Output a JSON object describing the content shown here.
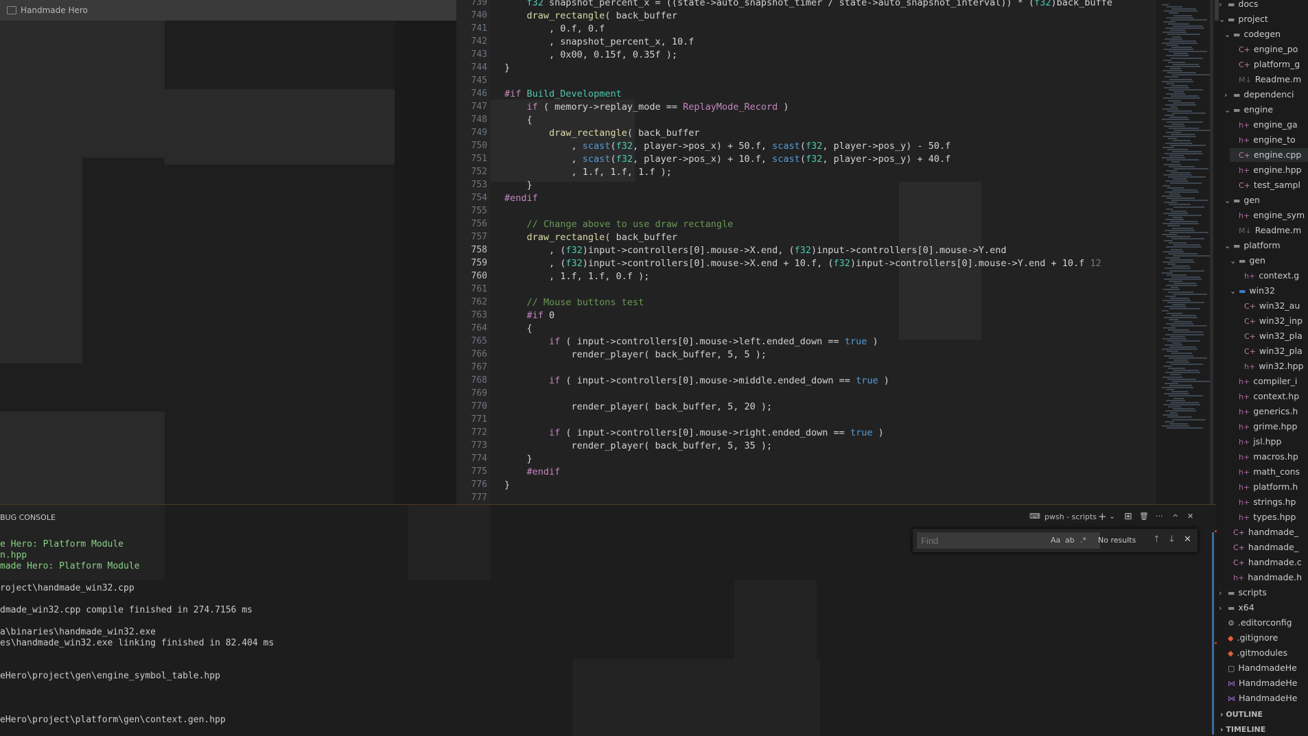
{
  "window": {
    "title": "Handmade Hero",
    "close_glyph": "✕"
  },
  "editor": {
    "lines": [
      {
        "n": "739",
        "html": "    <span style=\"color:#4ec9b0\">f32</span> snapshot_percent_x = ((state-&gt;auto_snapshot_timer / state-&gt;auto_snapshot_interval)) * (<span style=\"color:#4ec9b0\">f32</span>)back_buffe"
      },
      {
        "n": "740",
        "html": "    <span style=\"color:#dcdcaa\">draw_rectangle</span>( back_buffer"
      },
      {
        "n": "741",
        "html": "        , 0.f, 0.f"
      },
      {
        "n": "742",
        "html": "        , snapshot_percent_x, 10.f"
      },
      {
        "n": "743",
        "html": "        , 0x00, 0.15f, 0.35f );"
      },
      {
        "n": "744",
        "html": "}"
      },
      {
        "n": "745",
        "html": ""
      },
      {
        "n": "746",
        "html": "<span style=\"color:#c586c0\">#if</span> <span style=\"color:#4ec9b0\">Build_Development</span>"
      },
      {
        "n": "747",
        "html": "    <span style=\"color:#c586c0\">if</span> ( memory-&gt;replay_mode == <span style=\"color:#c586c0\">ReplayMode_Record</span> )"
      },
      {
        "n": "748",
        "html": "    {"
      },
      {
        "n": "749",
        "html": "        <span style=\"color:#dcdcaa\">draw_rectangle</span>( back_buffer"
      },
      {
        "n": "750",
        "html": "            , <span style=\"color:#569cd6\">scast</span>(<span style=\"color:#4ec9b0\">f32</span>, player-&gt;pos_x) + 50.f, <span style=\"color:#569cd6\">scast</span>(<span style=\"color:#4ec9b0\">f32</span>, player-&gt;pos_y) - 50.f"
      },
      {
        "n": "751",
        "html": "            , <span style=\"color:#569cd6\">scast</span>(<span style=\"color:#4ec9b0\">f32</span>, player-&gt;pos_x) + 10.f, <span style=\"color:#569cd6\">scast</span>(<span style=\"color:#4ec9b0\">f32</span>, player-&gt;pos_y) + 40.f"
      },
      {
        "n": "752",
        "html": "            , 1.f, 1.f, 1.f );"
      },
      {
        "n": "753",
        "html": "    }"
      },
      {
        "n": "754",
        "html": "<span style=\"color:#c586c0\">#endif</span>"
      },
      {
        "n": "755",
        "html": ""
      },
      {
        "n": "756",
        "html": "    <span style=\"color:#6a9955\">// Change above to use draw rectangle</span>"
      },
      {
        "n": "757",
        "html": "    <span style=\"color:#dcdcaa\">draw_rectangle</span>( back_buffer"
      },
      {
        "n": "758",
        "html": "        , (<span style=\"color:#4ec9b0\">f32</span>)input-&gt;controllers[0].mouse-&gt;X.end, (<span style=\"color:#4ec9b0\">f32</span>)input-&gt;controllers[0].mouse-&gt;Y.end"
      },
      {
        "n": "759",
        "html": "        , (<span style=\"color:#4ec9b0\">f32</span>)input-&gt;controllers[0].mouse-&gt;X.end + 10.f, (<span style=\"color:#4ec9b0\">f32</span>)input-&gt;controllers[0].mouse-&gt;Y.end + 10.f <span style=\"color:#777\">12</span>"
      },
      {
        "n": "760",
        "html": "        , 1.f, 1.f, 0.f );"
      },
      {
        "n": "761",
        "html": ""
      },
      {
        "n": "762",
        "html": "    <span style=\"color:#6a9955\">// Mouse buttons test</span>"
      },
      {
        "n": "763",
        "html": "    <span style=\"color:#c586c0\">#if</span> 0"
      },
      {
        "n": "764",
        "html": "    {"
      },
      {
        "n": "765",
        "html": "        <span style=\"color:#c586c0\">if</span> ( input-&gt;controllers[0].mouse-&gt;left.ended_down == <span style=\"color:#569cd6\">true</span> )"
      },
      {
        "n": "766",
        "html": "            render_player( back_buffer, 5, 5 );"
      },
      {
        "n": "767",
        "html": ""
      },
      {
        "n": "768",
        "html": "        <span style=\"color:#c586c0\">if</span> ( input-&gt;controllers[0].mouse-&gt;middle.ended_down == <span style=\"color:#569cd6\">true</span> )"
      },
      {
        "n": "769",
        "html": ""
      },
      {
        "n": "770",
        "html": "            render_player( back_buffer, 5, 20 );"
      },
      {
        "n": "771",
        "html": ""
      },
      {
        "n": "772",
        "html": "        <span style=\"color:#c586c0\">if</span> ( input-&gt;controllers[0].mouse-&gt;right.ended_down == <span style=\"color:#569cd6\">true</span> )"
      },
      {
        "n": "773",
        "html": "            render_player( back_buffer, 5, 35 );"
      },
      {
        "n": "774",
        "html": "    }"
      },
      {
        "n": "775",
        "html": "    <span style=\"color:#c586c0\">#endif</span>"
      },
      {
        "n": "776",
        "html": "}"
      },
      {
        "n": "777",
        "html": ""
      }
    ]
  },
  "terminal": {
    "tab_label": "BUG CONSOLE",
    "shell_label": "pwsh - scripts",
    "lines": [
      {
        "text": "e Hero: Platform Module",
        "green": true
      },
      {
        "text": "n.hpp",
        "green": true
      },
      {
        "text": "made Hero: Platform Module",
        "green": true
      },
      {
        "text": "",
        "green": false
      },
      {
        "text": "roject\\handmade_win32.cpp",
        "green": false
      },
      {
        "text": "",
        "green": false
      },
      {
        "text": "dmade_win32.cpp compile finished in 274.7156 ms",
        "green": false
      },
      {
        "text": "",
        "green": false
      },
      {
        "text": "a\\binaries\\handmade_win32.exe",
        "green": false
      },
      {
        "text": "es\\handmade_win32.exe linking finished in 82.404 ms",
        "green": false
      },
      {
        "text": "",
        "green": false
      },
      {
        "text": "",
        "green": false
      },
      {
        "text": "eHero\\project\\gen\\engine_symbol_table.hpp",
        "green": false
      },
      {
        "text": "",
        "green": false
      },
      {
        "text": "",
        "green": false
      },
      {
        "text": "",
        "green": false
      },
      {
        "text": "eHero\\project\\platform\\gen\\context.gen.hpp",
        "green": false
      }
    ],
    "find": {
      "placeholder": "Find",
      "match_case": "Aa",
      "whole_word": "ab",
      "regex": ".*",
      "results": "No results",
      "prev": "↑",
      "next": "↓",
      "close": "✕"
    },
    "tools": {
      "add": "+",
      "split": "⊞",
      "trash": "🗑",
      "more": "···",
      "maximize": "^",
      "close": "✕"
    }
  },
  "explorer": {
    "items": [
      {
        "label": "docs",
        "depth": 0,
        "type": "folder",
        "chev": "›",
        "icon_color": "#8a8a8a"
      },
      {
        "label": "project",
        "depth": 0,
        "type": "folder",
        "chev": "⌄",
        "icon_color": "#8a8a8a"
      },
      {
        "label": "codegen",
        "depth": 1,
        "type": "folder",
        "chev": "⌄",
        "icon_color": "#8a8a8a"
      },
      {
        "label": "engine_po",
        "depth": 2,
        "type": "cpp",
        "chev": "",
        "icon_color": "#c47ba8"
      },
      {
        "label": "platform_g",
        "depth": 2,
        "type": "cpp",
        "chev": "",
        "icon_color": "#c47ba8"
      },
      {
        "label": "Readme.m",
        "depth": 2,
        "type": "md",
        "chev": "",
        "icon_color": "#666"
      },
      {
        "label": "dependenci",
        "depth": 1,
        "type": "folder",
        "chev": "›",
        "icon_color": "#8a8a8a"
      },
      {
        "label": "engine",
        "depth": 1,
        "type": "folder",
        "chev": "⌄",
        "icon_color": "#8a8a8a"
      },
      {
        "label": "engine_ga",
        "depth": 2,
        "type": "hpp",
        "chev": "",
        "icon_color": "#a86a9a"
      },
      {
        "label": "engine_to",
        "depth": 2,
        "type": "hpp",
        "chev": "",
        "icon_color": "#a86a9a"
      },
      {
        "label": "engine.cpp",
        "depth": 2,
        "type": "cpp",
        "chev": "",
        "icon_color": "#c47ba8",
        "selected": true
      },
      {
        "label": "engine.hpp",
        "depth": 2,
        "type": "hpp",
        "chev": "",
        "icon_color": "#a86a9a"
      },
      {
        "label": "test_sampl",
        "depth": 2,
        "type": "cpp",
        "chev": "",
        "icon_color": "#c47ba8"
      },
      {
        "label": "gen",
        "depth": 1,
        "type": "folder",
        "chev": "⌄",
        "icon_color": "#8a8a8a"
      },
      {
        "label": "engine_sym",
        "depth": 2,
        "type": "hpp",
        "chev": "",
        "icon_color": "#a86a9a"
      },
      {
        "label": "Readme.m",
        "depth": 2,
        "type": "md",
        "chev": "",
        "icon_color": "#666"
      },
      {
        "label": "platform",
        "depth": 1,
        "type": "folder",
        "chev": "⌄",
        "icon_color": "#8a8a8a"
      },
      {
        "label": "gen",
        "depth": 2,
        "type": "folder",
        "chev": "⌄",
        "icon_color": "#8a8a8a"
      },
      {
        "label": "context.g",
        "depth": 3,
        "type": "hpp",
        "chev": "",
        "icon_color": "#a86a9a"
      },
      {
        "label": "win32",
        "depth": 2,
        "type": "folder",
        "chev": "⌄",
        "icon_color": "#3a7bd5"
      },
      {
        "label": "win32_au",
        "depth": 3,
        "type": "cpp",
        "chev": "",
        "icon_color": "#c47ba8"
      },
      {
        "label": "win32_inp",
        "depth": 3,
        "type": "cpp",
        "chev": "",
        "icon_color": "#c47ba8"
      },
      {
        "label": "win32_pla",
        "depth": 3,
        "type": "cpp",
        "chev": "",
        "icon_color": "#c47ba8"
      },
      {
        "label": "win32_pla",
        "depth": 3,
        "type": "cpp",
        "chev": "",
        "icon_color": "#c47ba8"
      },
      {
        "label": "win32.hpp",
        "depth": 3,
        "type": "hpp",
        "chev": "",
        "icon_color": "#a86a9a"
      },
      {
        "label": "compiler_i",
        "depth": 2,
        "type": "hpp",
        "chev": "",
        "icon_color": "#a86a9a"
      },
      {
        "label": "context.hp",
        "depth": 2,
        "type": "hpp",
        "chev": "",
        "icon_color": "#a86a9a"
      },
      {
        "label": "generics.h",
        "depth": 2,
        "type": "hpp",
        "chev": "",
        "icon_color": "#a86a9a"
      },
      {
        "label": "grime.hpp",
        "depth": 2,
        "type": "hpp",
        "chev": "",
        "icon_color": "#a86a9a"
      },
      {
        "label": "jsl.hpp",
        "depth": 2,
        "type": "hpp",
        "chev": "",
        "icon_color": "#a86a9a"
      },
      {
        "label": "macros.hp",
        "depth": 2,
        "type": "hpp",
        "chev": "",
        "icon_color": "#a86a9a"
      },
      {
        "label": "math_cons",
        "depth": 2,
        "type": "hpp",
        "chev": "",
        "icon_color": "#a86a9a"
      },
      {
        "label": "platform.h",
        "depth": 2,
        "type": "hpp",
        "chev": "",
        "icon_color": "#a86a9a"
      },
      {
        "label": "strings.hp",
        "depth": 2,
        "type": "hpp",
        "chev": "",
        "icon_color": "#a86a9a"
      },
      {
        "label": "types.hpp",
        "depth": 2,
        "type": "hpp",
        "chev": "",
        "icon_color": "#a86a9a"
      },
      {
        "label": "handmade_",
        "depth": 1,
        "type": "cpp",
        "chev": "",
        "icon_color": "#c47ba8"
      },
      {
        "label": "handmade_",
        "depth": 1,
        "type": "cpp",
        "chev": "",
        "icon_color": "#c47ba8"
      },
      {
        "label": "handmade.c",
        "depth": 1,
        "type": "cpp",
        "chev": "",
        "icon_color": "#c47ba8"
      },
      {
        "label": "handmade.h",
        "depth": 1,
        "type": "hpp",
        "chev": "",
        "icon_color": "#a86a9a"
      },
      {
        "label": "scripts",
        "depth": 0,
        "type": "folder",
        "chev": "›",
        "icon_color": "#8a8a8a"
      },
      {
        "label": "x64",
        "depth": 0,
        "type": "folder",
        "chev": "›",
        "icon_color": "#8a8a8a"
      },
      {
        "label": ".editorconfig",
        "depth": 0,
        "type": "gear",
        "chev": "",
        "icon_color": "#aaaaaa"
      },
      {
        "label": ".gitignore",
        "depth": 0,
        "type": "git",
        "chev": "",
        "icon_color": "#e0603a"
      },
      {
        "label": ".gitmodules",
        "depth": 0,
        "type": "git",
        "chev": "",
        "icon_color": "#e0603a"
      },
      {
        "label": "HandmadeHe",
        "depth": 0,
        "type": "file",
        "chev": "",
        "icon_color": "#aaaaaa"
      },
      {
        "label": "HandmadeHe",
        "depth": 0,
        "type": "vs",
        "chev": "",
        "icon_color": "#9a6ad8"
      },
      {
        "label": "HandmadeHe",
        "depth": 0,
        "type": "vs",
        "chev": "",
        "icon_color": "#9a6ad8"
      }
    ],
    "outline_label": "OUTLINE",
    "timeline_label": "TIMELINE"
  }
}
